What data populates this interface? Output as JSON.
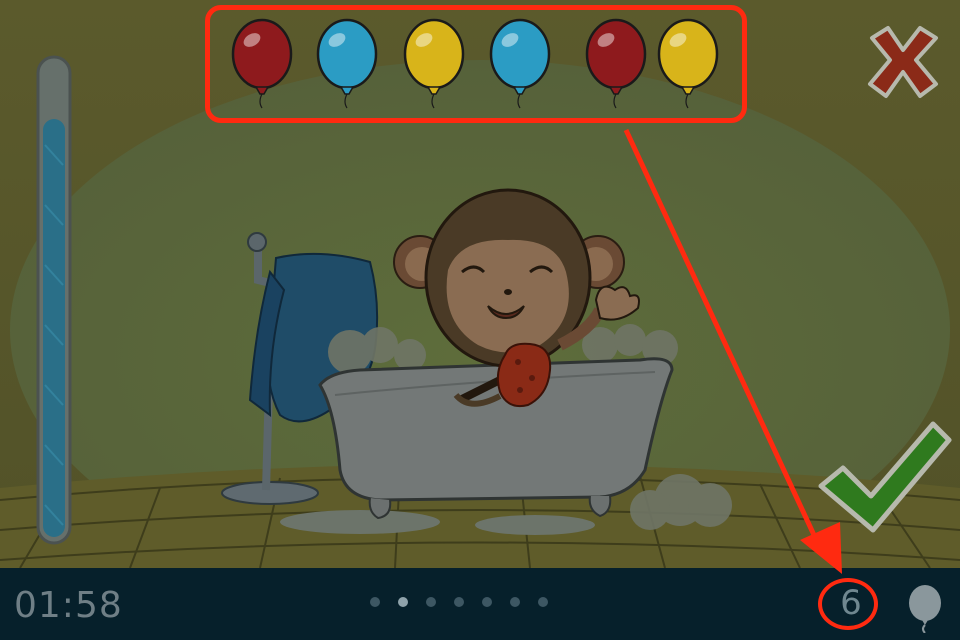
{
  "game": {
    "timer": "01:58",
    "balloon_count": "6",
    "pagination": {
      "total": 7,
      "active_index": 1
    },
    "water_level": 0.88,
    "balloons": [
      {
        "color_name": "red",
        "color": "#8e1a1d"
      },
      {
        "color_name": "blue",
        "color": "#2b9cc4"
      },
      {
        "color_name": "yellow",
        "color": "#d8b41a"
      },
      {
        "color_name": "blue",
        "color": "#2b9cc4"
      },
      {
        "color_name": "red",
        "color": "#8e1a1d"
      },
      {
        "color_name": "yellow",
        "color": "#d8b41a"
      }
    ]
  },
  "colors": {
    "annotation": "#ff2a10",
    "hud_bar": "#06202b",
    "close_x": "#8b2a18",
    "check": "#2f7a1e"
  },
  "icons": [
    "close-icon",
    "check-icon",
    "balloon-icon",
    "water-meter"
  ]
}
